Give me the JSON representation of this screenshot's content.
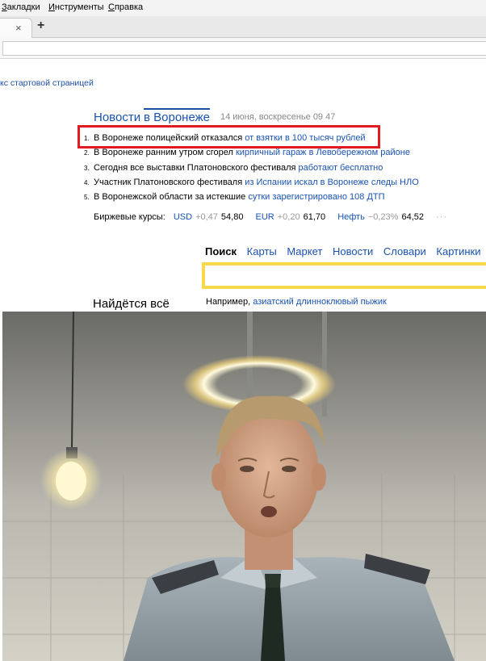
{
  "menu": {
    "items": [
      "Закладки",
      "Инструменты",
      "Справка"
    ]
  },
  "tabbar": {
    "close_glyph": "×",
    "new_tab_glyph": "+"
  },
  "page": {
    "home_link": "кс стартовой страницей",
    "news_tab": "Новости",
    "region_tab": "в Воронеже",
    "date": "14 июня, воскресенье 09 47",
    "news": [
      {
        "num": "1.",
        "text": "В Воронеже полицейский отказался ",
        "link": "от взятки в 100 тысяч рублей"
      },
      {
        "num": "2.",
        "text": "В Воронеже ранним утром сгорел ",
        "link": "кирпичный гараж в Левобережном районе"
      },
      {
        "num": "3.",
        "text": "Сегодня все выставки Платоновского фестиваля ",
        "link": "работают бесплатно"
      },
      {
        "num": "4.",
        "text": "Участник Платоновского фестиваля ",
        "link": "из Испании искал в Воронеже следы НЛО"
      },
      {
        "num": "5.",
        "text": "В Воронежской области за истекшие ",
        "link": "сутки зарегистрировано 108 ДТП"
      }
    ],
    "rates": {
      "label": "Биржевые курсы:",
      "items": [
        {
          "currency": "USD",
          "delta": "+0,47",
          "value": "54,80"
        },
        {
          "currency": "EUR",
          "delta": "+0,20",
          "value": "61,70"
        },
        {
          "currency": "Нефть",
          "delta": "−0,23%",
          "value": "64,52"
        }
      ],
      "more": "···"
    },
    "search_tabs": [
      "Поиск",
      "Карты",
      "Маркет",
      "Новости",
      "Словари",
      "Картинки"
    ],
    "slogan": "Найдётся всё",
    "example_label": "Например, ",
    "example_link": "азиатский длинноклювый пыжик"
  },
  "colors": {
    "link": "#1a52b0",
    "highlight": "#e11a22",
    "search_border": "#f7d84a"
  }
}
